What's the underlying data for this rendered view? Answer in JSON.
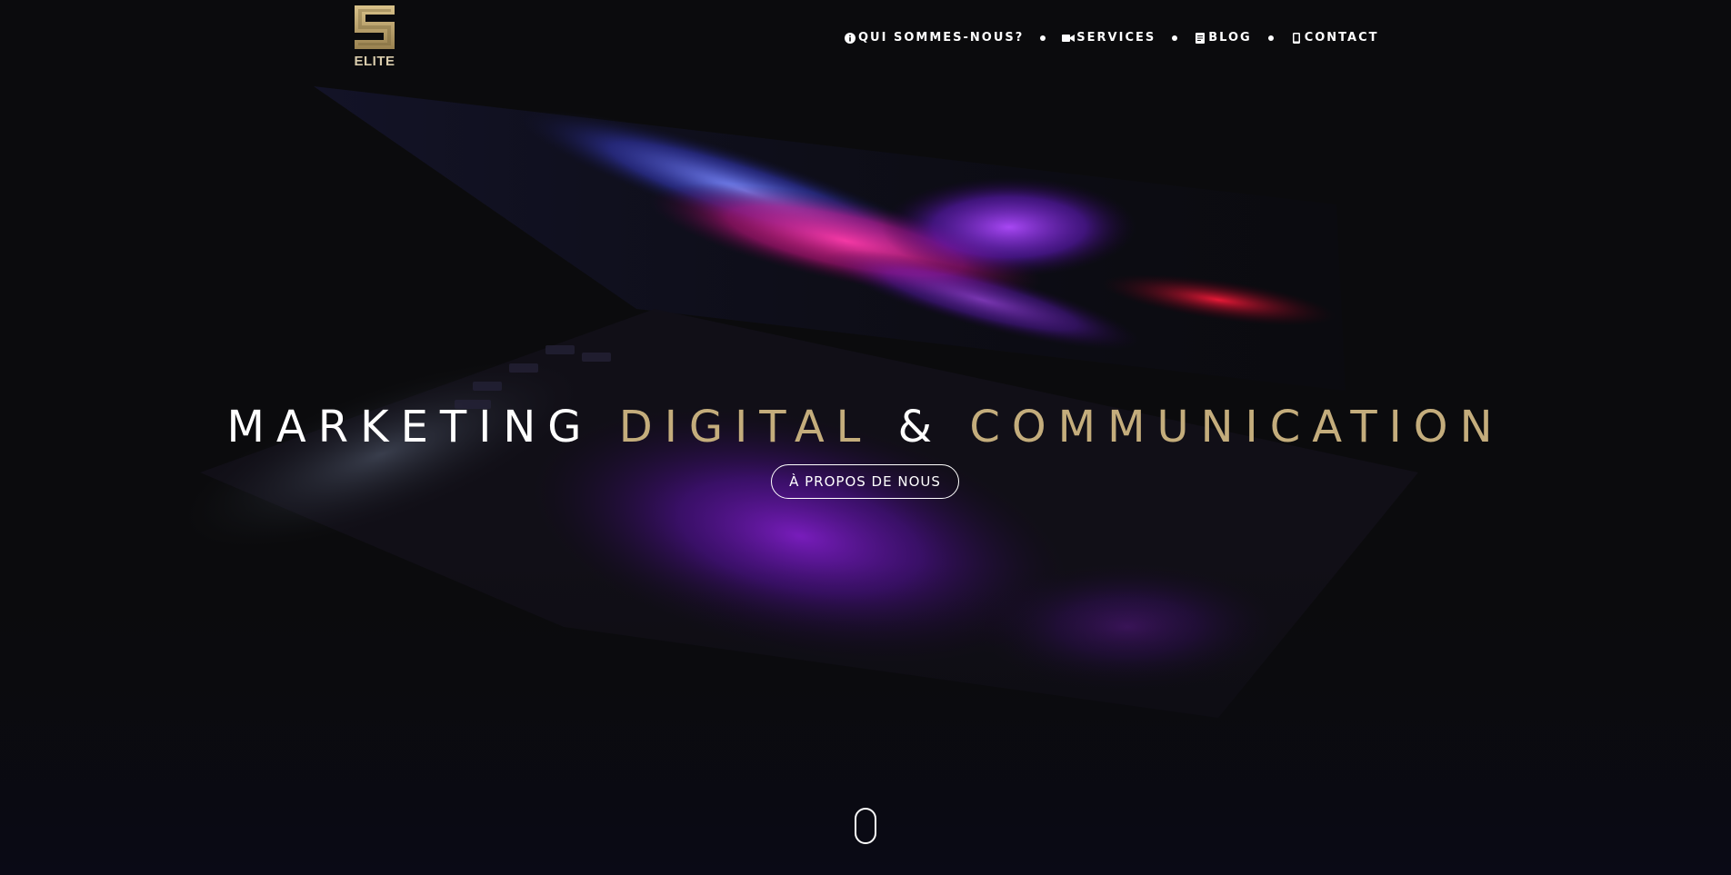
{
  "brand": {
    "logo_text": "ELITE",
    "gold": "#c4ad7c"
  },
  "nav": {
    "items": [
      {
        "label": "QUI SOMMES-NOUS?",
        "icon": "info-circle-icon"
      },
      {
        "label": "SERVICES",
        "icon": "video-camera-icon"
      },
      {
        "label": "BLOG",
        "icon": "document-icon"
      },
      {
        "label": "CONTACT",
        "icon": "mobile-phone-icon"
      }
    ]
  },
  "hero": {
    "headline_white_1": "MARKETING",
    "headline_gold_1": "DIGITAL",
    "headline_white_2": "&",
    "headline_gold_2": "COMMUNICATION",
    "cta_label": "À PROPOS DE NOUS",
    "scroll_icon": "mouse-scroll-icon"
  },
  "colors": {
    "background": "#0b0b0d",
    "text": "#ffffff",
    "accent": "#c4ad7c"
  }
}
